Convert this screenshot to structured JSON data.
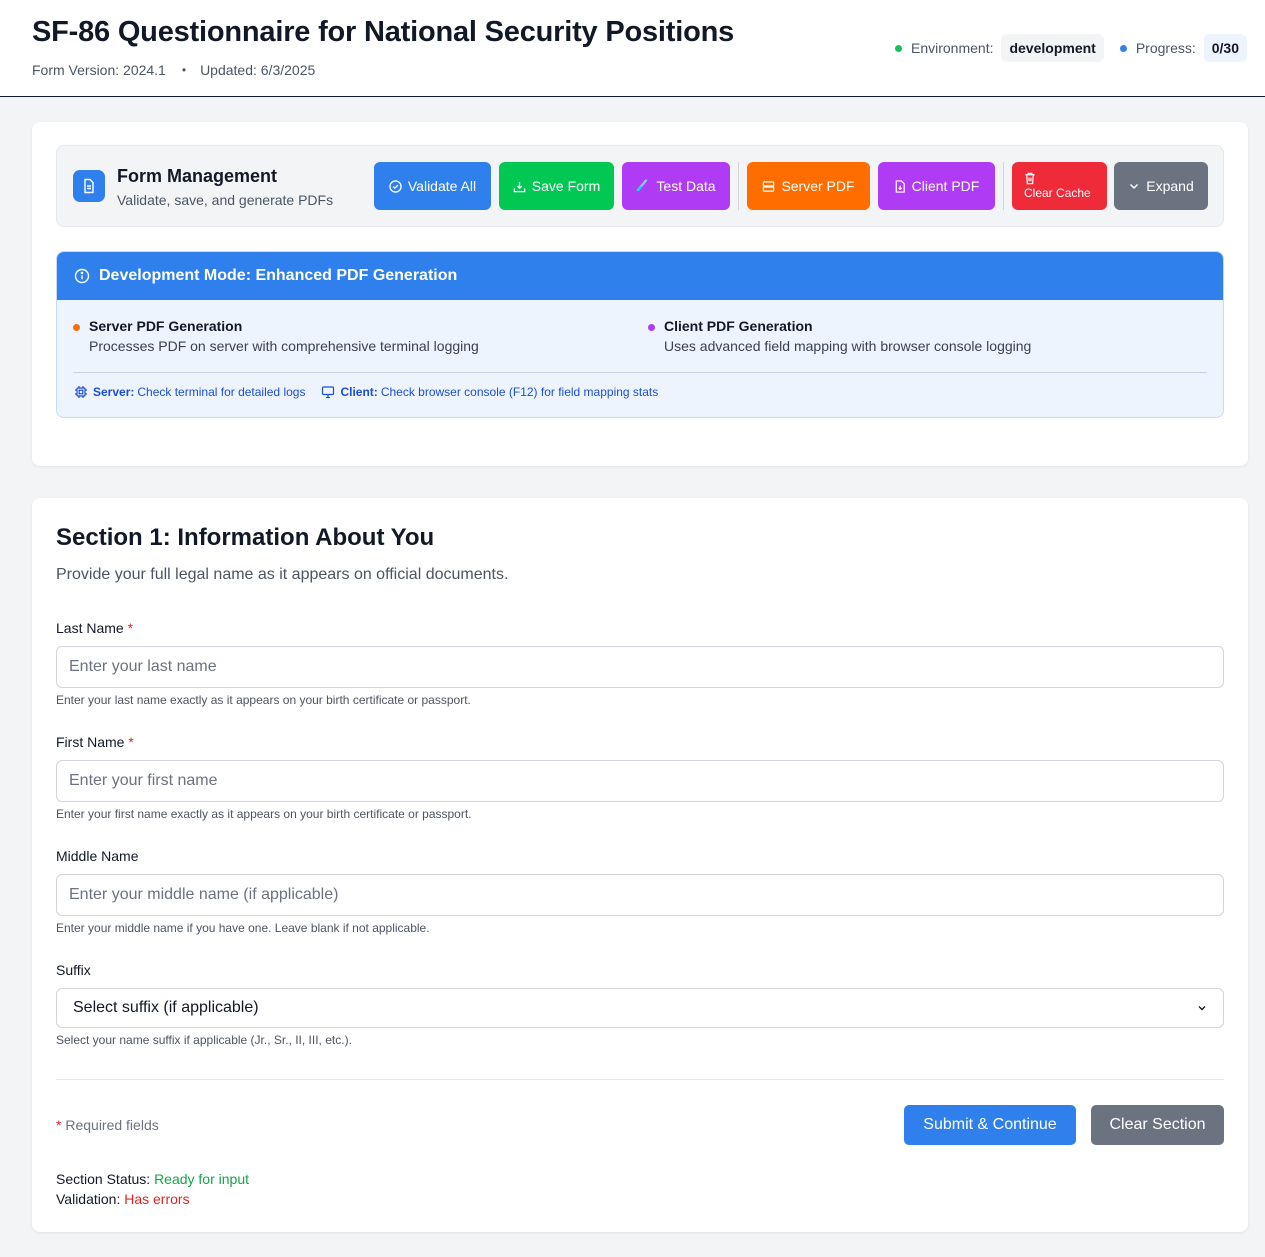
{
  "header": {
    "title": "SF-86 Questionnaire for National Security Positions",
    "form_version": "Form Version: 2024.1",
    "separator": "•",
    "updated": "Updated: 6/3/2025",
    "environment_label": "Environment:",
    "environment_value": "development",
    "progress_label": "Progress:",
    "progress_value": "0/30"
  },
  "management": {
    "title": "Form Management",
    "subtitle": "Validate, save, and generate PDFs",
    "buttons": {
      "validate_all": "Validate All",
      "save_form": "Save Form",
      "test_data": "Test Data",
      "server_pdf": "Server PDF",
      "client_pdf": "Client PDF",
      "clear_cache": "Clear Cache",
      "expand": "Expand"
    }
  },
  "dev_mode": {
    "title": "Development Mode: Enhanced PDF Generation",
    "server_heading": "Server PDF Generation",
    "server_desc": "Processes PDF on server with comprehensive terminal logging",
    "client_heading": "Client PDF Generation",
    "client_desc": "Uses advanced field mapping with browser console logging",
    "server_note_label": "Server:",
    "server_note_text": "Check terminal for detailed logs",
    "client_note_label": "Client:",
    "client_note_text": "Check browser console (F12) for field mapping stats"
  },
  "section": {
    "title": "Section 1: Information About You",
    "description": "Provide your full legal name as it appears on official documents.",
    "required_mark": "*",
    "last_name": {
      "label": "Last Name",
      "placeholder": "Enter your last name",
      "help": "Enter your last name exactly as it appears on your birth certificate or passport."
    },
    "first_name": {
      "label": "First Name",
      "placeholder": "Enter your first name",
      "help": "Enter your first name exactly as it appears on your birth certificate or passport."
    },
    "middle_name": {
      "label": "Middle Name",
      "placeholder": "Enter your middle name (if applicable)",
      "help": "Enter your middle name if you have one. Leave blank if not applicable."
    },
    "suffix": {
      "label": "Suffix",
      "selected": "Select suffix (if applicable)",
      "help": "Select your name suffix if applicable (Jr., Sr., II, III, etc.)."
    },
    "required_note": "Required fields",
    "submit_label": "Submit & Continue",
    "clear_label": "Clear Section",
    "status_label": "Section Status:",
    "status_value": "Ready for input",
    "validation_label": "Validation:",
    "validation_value": "Has errors"
  },
  "colors": {
    "primary": "#2f80ed",
    "green": "#00c853",
    "purple": "#b03bf5",
    "orange": "#ff6d00",
    "red": "#ef2b3a",
    "gray": "#6b7280"
  }
}
